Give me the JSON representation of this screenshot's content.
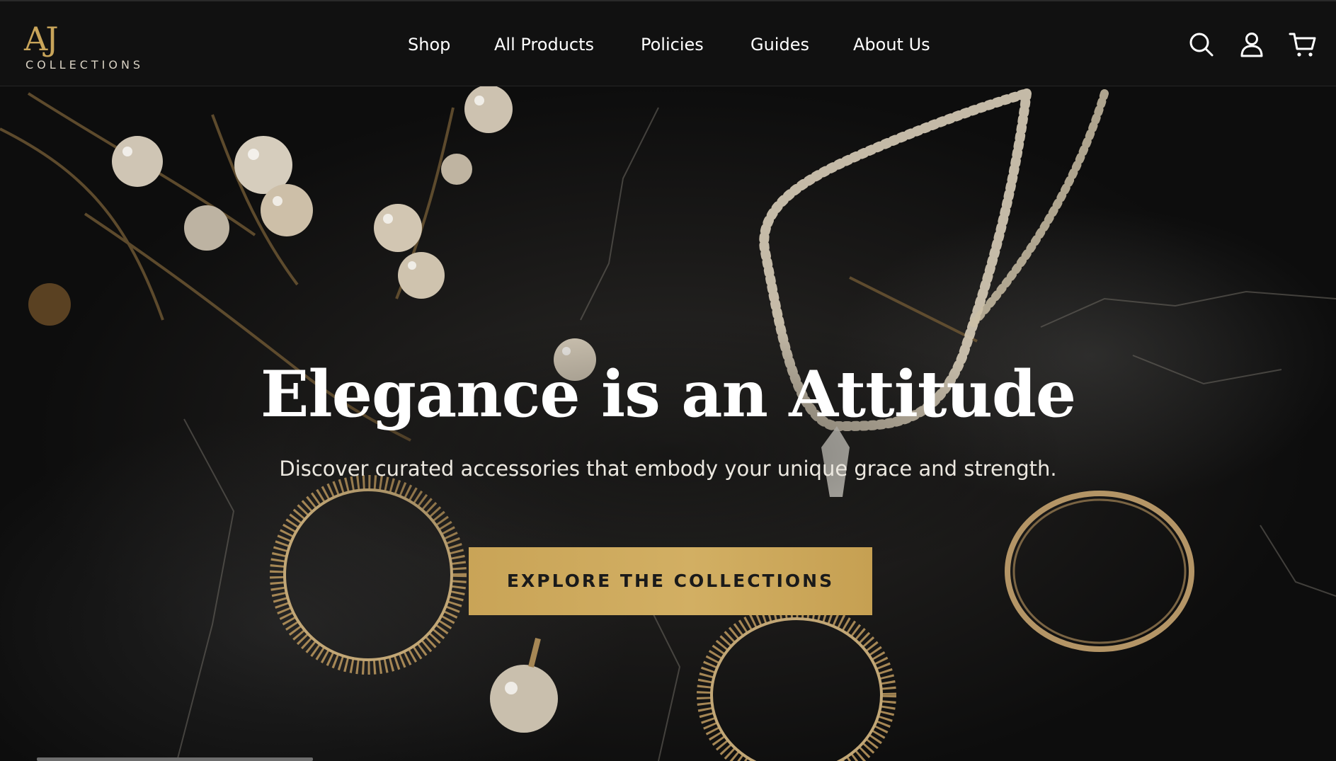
{
  "brand": {
    "mark": "AJ",
    "sub": "COLLECTIONS"
  },
  "nav": {
    "items": [
      {
        "label": "Shop"
      },
      {
        "label": "All Products"
      },
      {
        "label": "Policies"
      },
      {
        "label": "Guides"
      },
      {
        "label": "About Us"
      }
    ]
  },
  "icons": {
    "search": "search-icon",
    "account": "user-icon",
    "cart": "cart-icon"
  },
  "hero": {
    "title": "Elegance is an Attitude",
    "subtitle": "Discover curated accessories that embody your unique grace and strength.",
    "cta_label": "EXPLORE THE COLLECTIONS"
  },
  "colors": {
    "accent_gold": "#c9a55a",
    "header_bg": "#111111",
    "hero_bg": "#1a1918",
    "text": "#ffffff"
  }
}
